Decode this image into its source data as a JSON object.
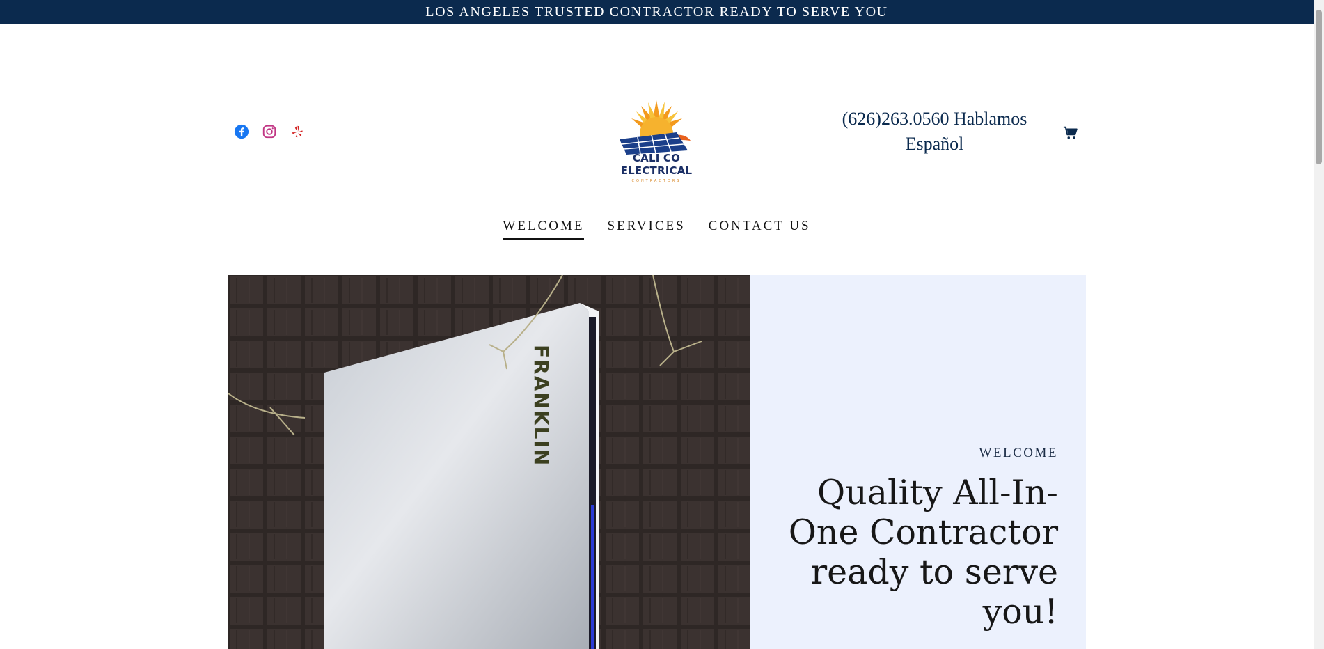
{
  "announcement": {
    "text": "LOS ANGELES TRUSTED CONTRACTOR READY TO SERVE YOU"
  },
  "header": {
    "social_icons": [
      "facebook-icon",
      "instagram-icon",
      "yelp-icon"
    ],
    "logo": {
      "brand": "CALI CO ELECTRICAL",
      "tagline": "CONTRACTORS"
    },
    "phone_line1": "(626)263.0560 Hablamos",
    "phone_line2": "Español",
    "cart_icon": "cart-icon"
  },
  "nav": {
    "items": [
      {
        "label": "WELCOME",
        "active": true
      },
      {
        "label": "SERVICES",
        "active": false
      },
      {
        "label": "CONTACT US",
        "active": false
      }
    ]
  },
  "hero": {
    "image_text": "FRANKLIN",
    "eyebrow": "WELCOME",
    "headline": "Quality All-In-One Contractor ready to serve you!"
  },
  "colors": {
    "announcement_bg": "#0b2a4e",
    "panel_bg": "#ecf1fd",
    "facebook": "#1877f2",
    "instagram": "#c13584",
    "yelp": "#d32323"
  }
}
